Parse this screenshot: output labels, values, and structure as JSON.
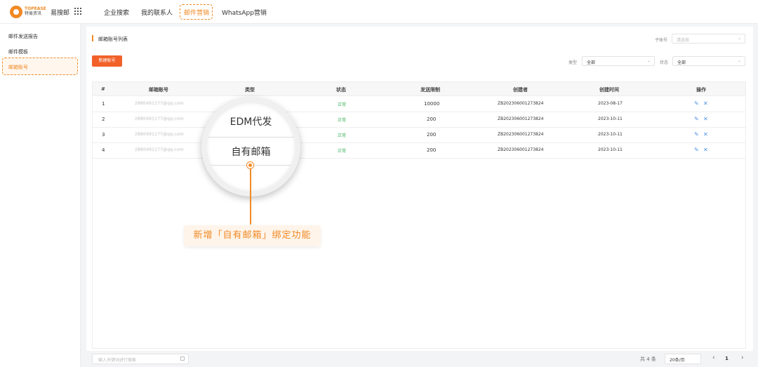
{
  "header": {
    "logo_brand": "TOPEASE",
    "logo_cn": "特易资讯",
    "product_name": "易搜邮",
    "nav": [
      "企业搜索",
      "我的联系人",
      "邮件营销",
      "WhatsApp营销"
    ],
    "active_nav_index": 2
  },
  "sidebar": {
    "items": [
      "邮件发送报告",
      "邮件模板",
      "邮箱账号"
    ],
    "active_index": 2
  },
  "main": {
    "title": "邮箱账号列表",
    "new_button": "新建账号",
    "filters": {
      "sub_account_label": "子账号",
      "sub_account_placeholder": "请选择",
      "type_label": "类型",
      "type_value": "全部",
      "status_label": "状态",
      "status_value": "全部"
    }
  },
  "table": {
    "columns": [
      "#",
      "邮箱账号",
      "类型",
      "状态",
      "发送限制",
      "创建者",
      "创建时间",
      "操作"
    ],
    "rows": [
      {
        "no": "1",
        "email": "2880491177@qq.com",
        "status": "正常",
        "limit": "10000",
        "creator": "ZB202306001273824",
        "created": "2023-08-17"
      },
      {
        "no": "2",
        "email": "2880491177@qq.com",
        "status": "正常",
        "limit": "200",
        "creator": "ZB202306001273824",
        "created": "2023-10-11"
      },
      {
        "no": "3",
        "email": "2880491177@qq.com",
        "status": "正常",
        "limit": "200",
        "creator": "ZB202306001273824",
        "created": "2023-10-11"
      },
      {
        "no": "4",
        "email": "2880491177@qq.com",
        "status": "正常",
        "limit": "200",
        "creator": "ZB202306001273824",
        "created": "2023-10-11"
      }
    ]
  },
  "footer": {
    "search_placeholder": "输入关键词进行搜索",
    "total": "共 4 条",
    "page_size": "20条/页",
    "prev": "‹",
    "page": "1",
    "next": "›"
  },
  "overlay": {
    "option_1": "EDM代发",
    "option_2": "自有邮箱",
    "callout": "新增「自有邮箱」绑定功能"
  },
  "colors": {
    "accent": "#f08a24",
    "button": "#f2612a",
    "status_ok": "#41b35a",
    "action": "#4a90e2"
  }
}
